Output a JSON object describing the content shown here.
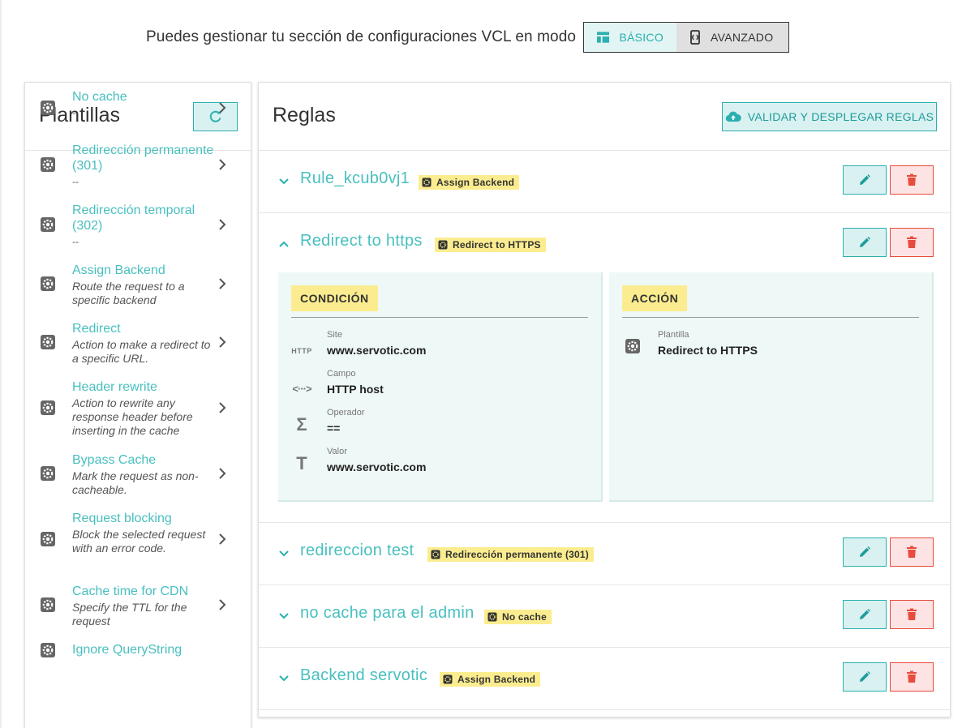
{
  "mode_bar": {
    "lead_text": "Puedes gestionar tu sección de configuraciones VCL en modo",
    "basic_label": "BÁSICO",
    "advanced_label": "AVANZADO"
  },
  "templates_panel": {
    "title": "Plantillas",
    "items": [
      {
        "name": "No cache",
        "description": "--"
      },
      {
        "name": "Redirección permanente (301)",
        "description": "--"
      },
      {
        "name": "Redirección temporal (302)",
        "description": "--"
      },
      {
        "name": "Assign Backend",
        "description": "Route the request to a specific backend"
      },
      {
        "name": "Redirect",
        "description": "Action to make a redirect to a specific URL."
      },
      {
        "name": "Header rewrite",
        "description": "Action to rewrite any response header before inserting in the cache"
      },
      {
        "name": "Bypass Cache",
        "description": "Mark the request as non-cacheable."
      },
      {
        "name": "Request blocking",
        "description": "Block the selected request with an error code."
      },
      {
        "name": "Cache time for CDN",
        "description": "Specify the TTL for the request"
      },
      {
        "name": "Ignore QueryString",
        "description": ""
      }
    ]
  },
  "rules_panel": {
    "title": "Reglas",
    "deploy_label": "VALIDAR Y DESPLEGAR REGLAS",
    "rules": [
      {
        "name": "Rule_kcub0vj1",
        "template": "Assign Backend",
        "expanded": false
      },
      {
        "name": "Redirect to https",
        "template": "Redirect to HTTPS",
        "expanded": true
      },
      {
        "name": "redireccion test",
        "template": "Redirección permanente (301)",
        "expanded": false
      },
      {
        "name": "no cache para el admin",
        "template": "No cache",
        "expanded": false
      },
      {
        "name": "Backend servotic",
        "template": "Assign Backend",
        "expanded": false
      }
    ],
    "detail": {
      "condition_header": "CONDICIÓN",
      "action_header": "ACCIÓN",
      "condition_fields": [
        {
          "icon": "http-icon",
          "icon_text": "HTTP",
          "label": "Site",
          "value": "www.servotic.com"
        },
        {
          "icon": "code-icon",
          "icon_text": "<···>",
          "label": "Campo",
          "value": "HTTP host"
        },
        {
          "icon": "sigma-icon",
          "icon_text": "Σ",
          "label": "Operador",
          "value": "=="
        },
        {
          "icon": "text-icon",
          "icon_text": "T",
          "label": "Valor",
          "value": "www.servotic.com"
        }
      ],
      "action_fields": [
        {
          "icon": "gear-icon",
          "label": "Plantilla",
          "value": "Redirect to HTTPS"
        }
      ]
    }
  },
  "colors": {
    "accent": "#2ab0b0",
    "accent_light": "#d9f1f0",
    "link": "#49bfbf",
    "danger": "#e74c3c",
    "danger_light": "#fde3e3",
    "tag": "#fbed8f",
    "detail_bg": "#eef8f6"
  }
}
